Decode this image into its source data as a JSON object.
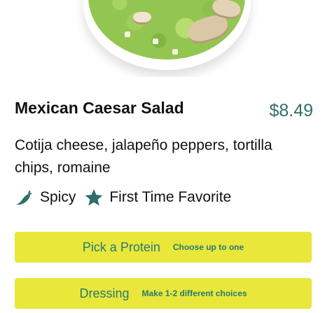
{
  "item": {
    "name": "Mexican Caesar Salad",
    "price": "$8.49",
    "description": "Cotija cheese, jalapeño peppers, tortilla chips, romaine"
  },
  "tags": [
    {
      "label": "Spicy",
      "icon": "chili-pepper-icon"
    },
    {
      "label": "First Time Favorite",
      "icon": "star-icon"
    }
  ],
  "options": {
    "protein": {
      "label": "Pick a Protein",
      "hint": "Choose up to one"
    },
    "dressing": {
      "label": "Dressing",
      "hint": "Make 1-2 different choices"
    }
  },
  "colors": {
    "price": "#2f6f6a",
    "button_bg": "#e8e73a",
    "button_text": "#2a7a72",
    "icon": "#2f6f6a"
  }
}
